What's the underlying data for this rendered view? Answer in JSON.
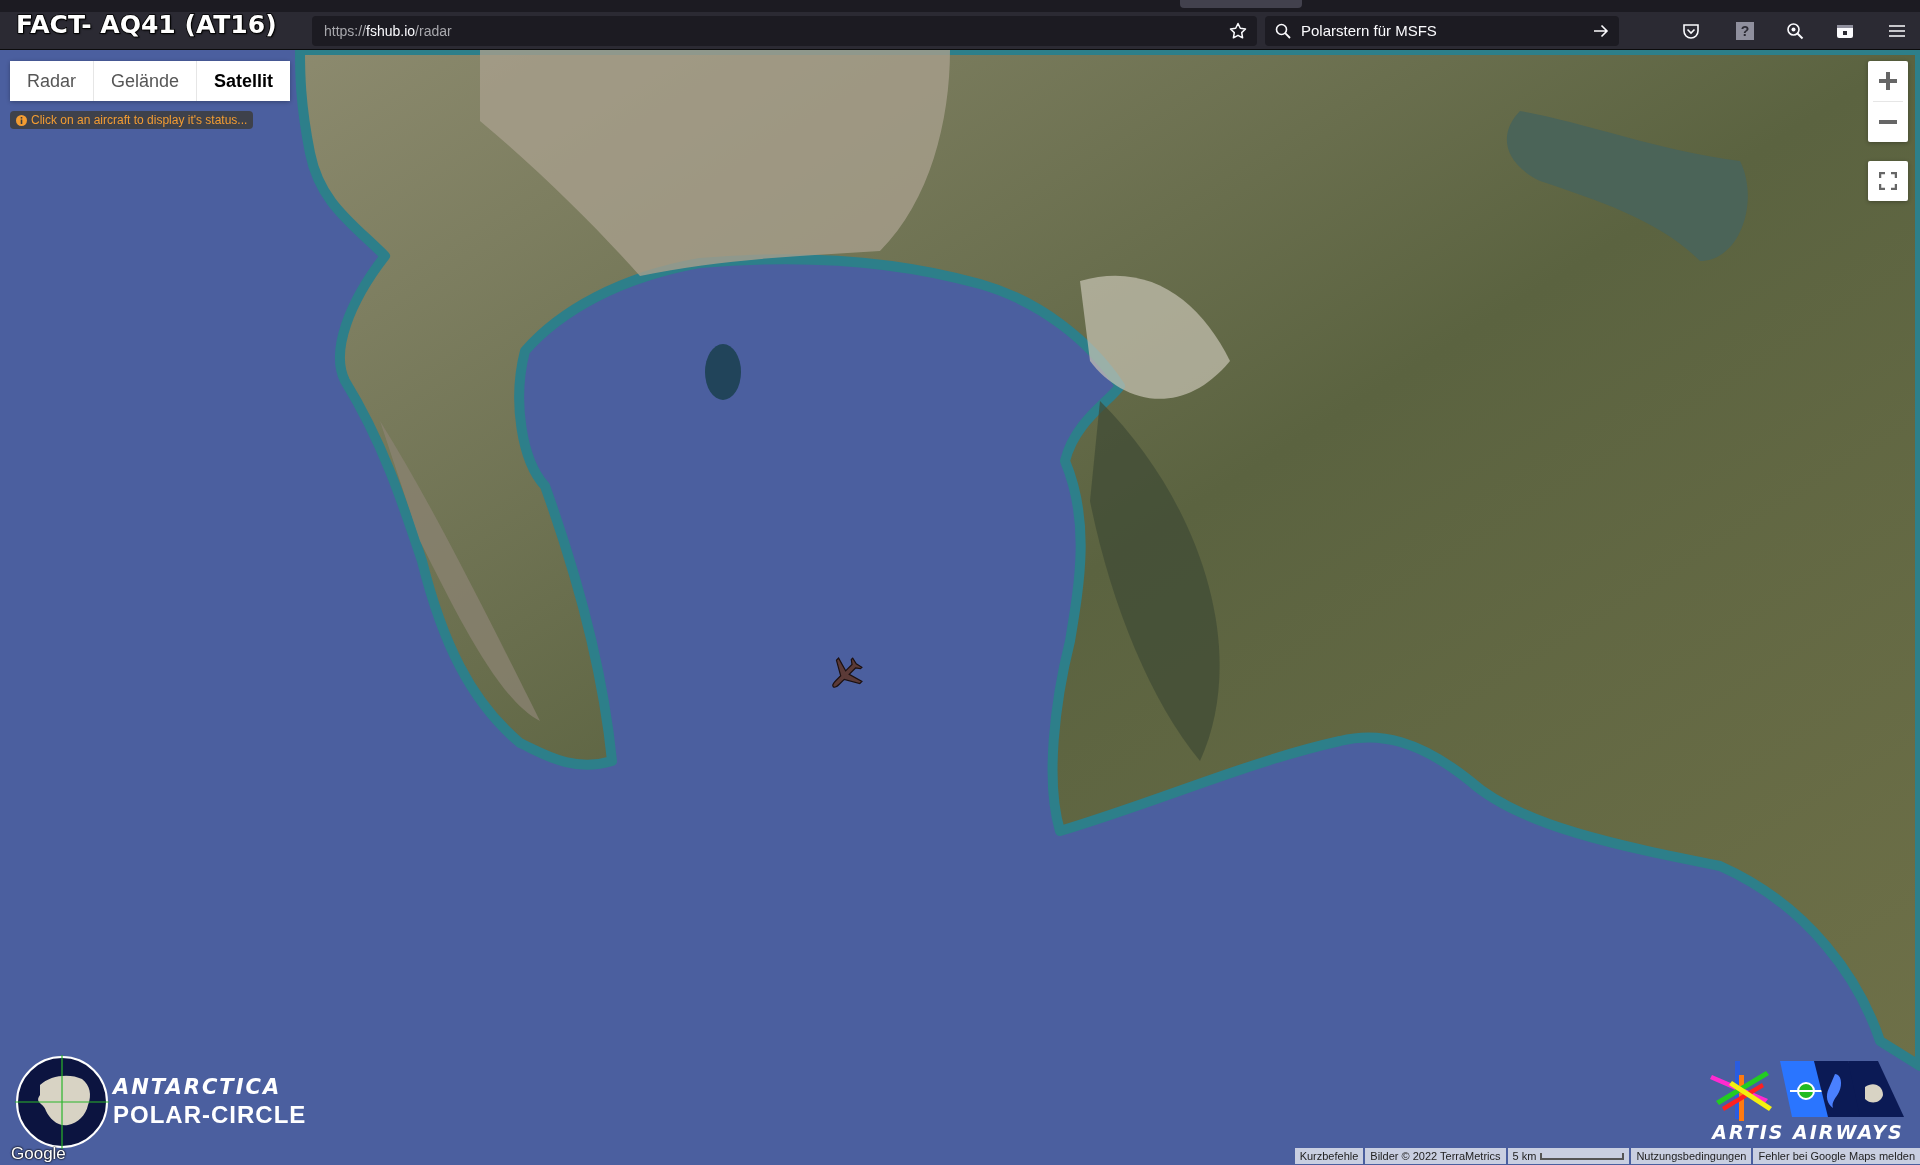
{
  "overlay_title": "FACT- AQ41 (AT16)",
  "address_bar": {
    "url_parts": [
      {
        "text": "https://",
        "highlighted": false
      },
      {
        "text": "fshub.io",
        "highlighted": true
      },
      {
        "text": "/radar",
        "highlighted": false
      }
    ]
  },
  "search": {
    "value": "Polarstern für MSFS"
  },
  "help_button": "?",
  "map_types": [
    {
      "label": "Radar",
      "selected": false
    },
    {
      "label": "Gelände",
      "selected": false
    },
    {
      "label": "Satellit",
      "selected": true
    }
  ],
  "hint": "Click on an aircraft to display it's status...",
  "antarctica_logo": {
    "line_1": "ANTARCTICA",
    "line_2": "POLAR-CIRCLE"
  },
  "google_logo": "Google",
  "airline_logo": "ARTIS AIRWAYS",
  "attribution": {
    "shortcuts": "Kurzbefehle",
    "imagery": "Bilder © 2022 TerraMetrics",
    "scale": "5 km",
    "terms": "Nutzungsbedingungen",
    "report": "Fehler bei Google Maps melden"
  }
}
